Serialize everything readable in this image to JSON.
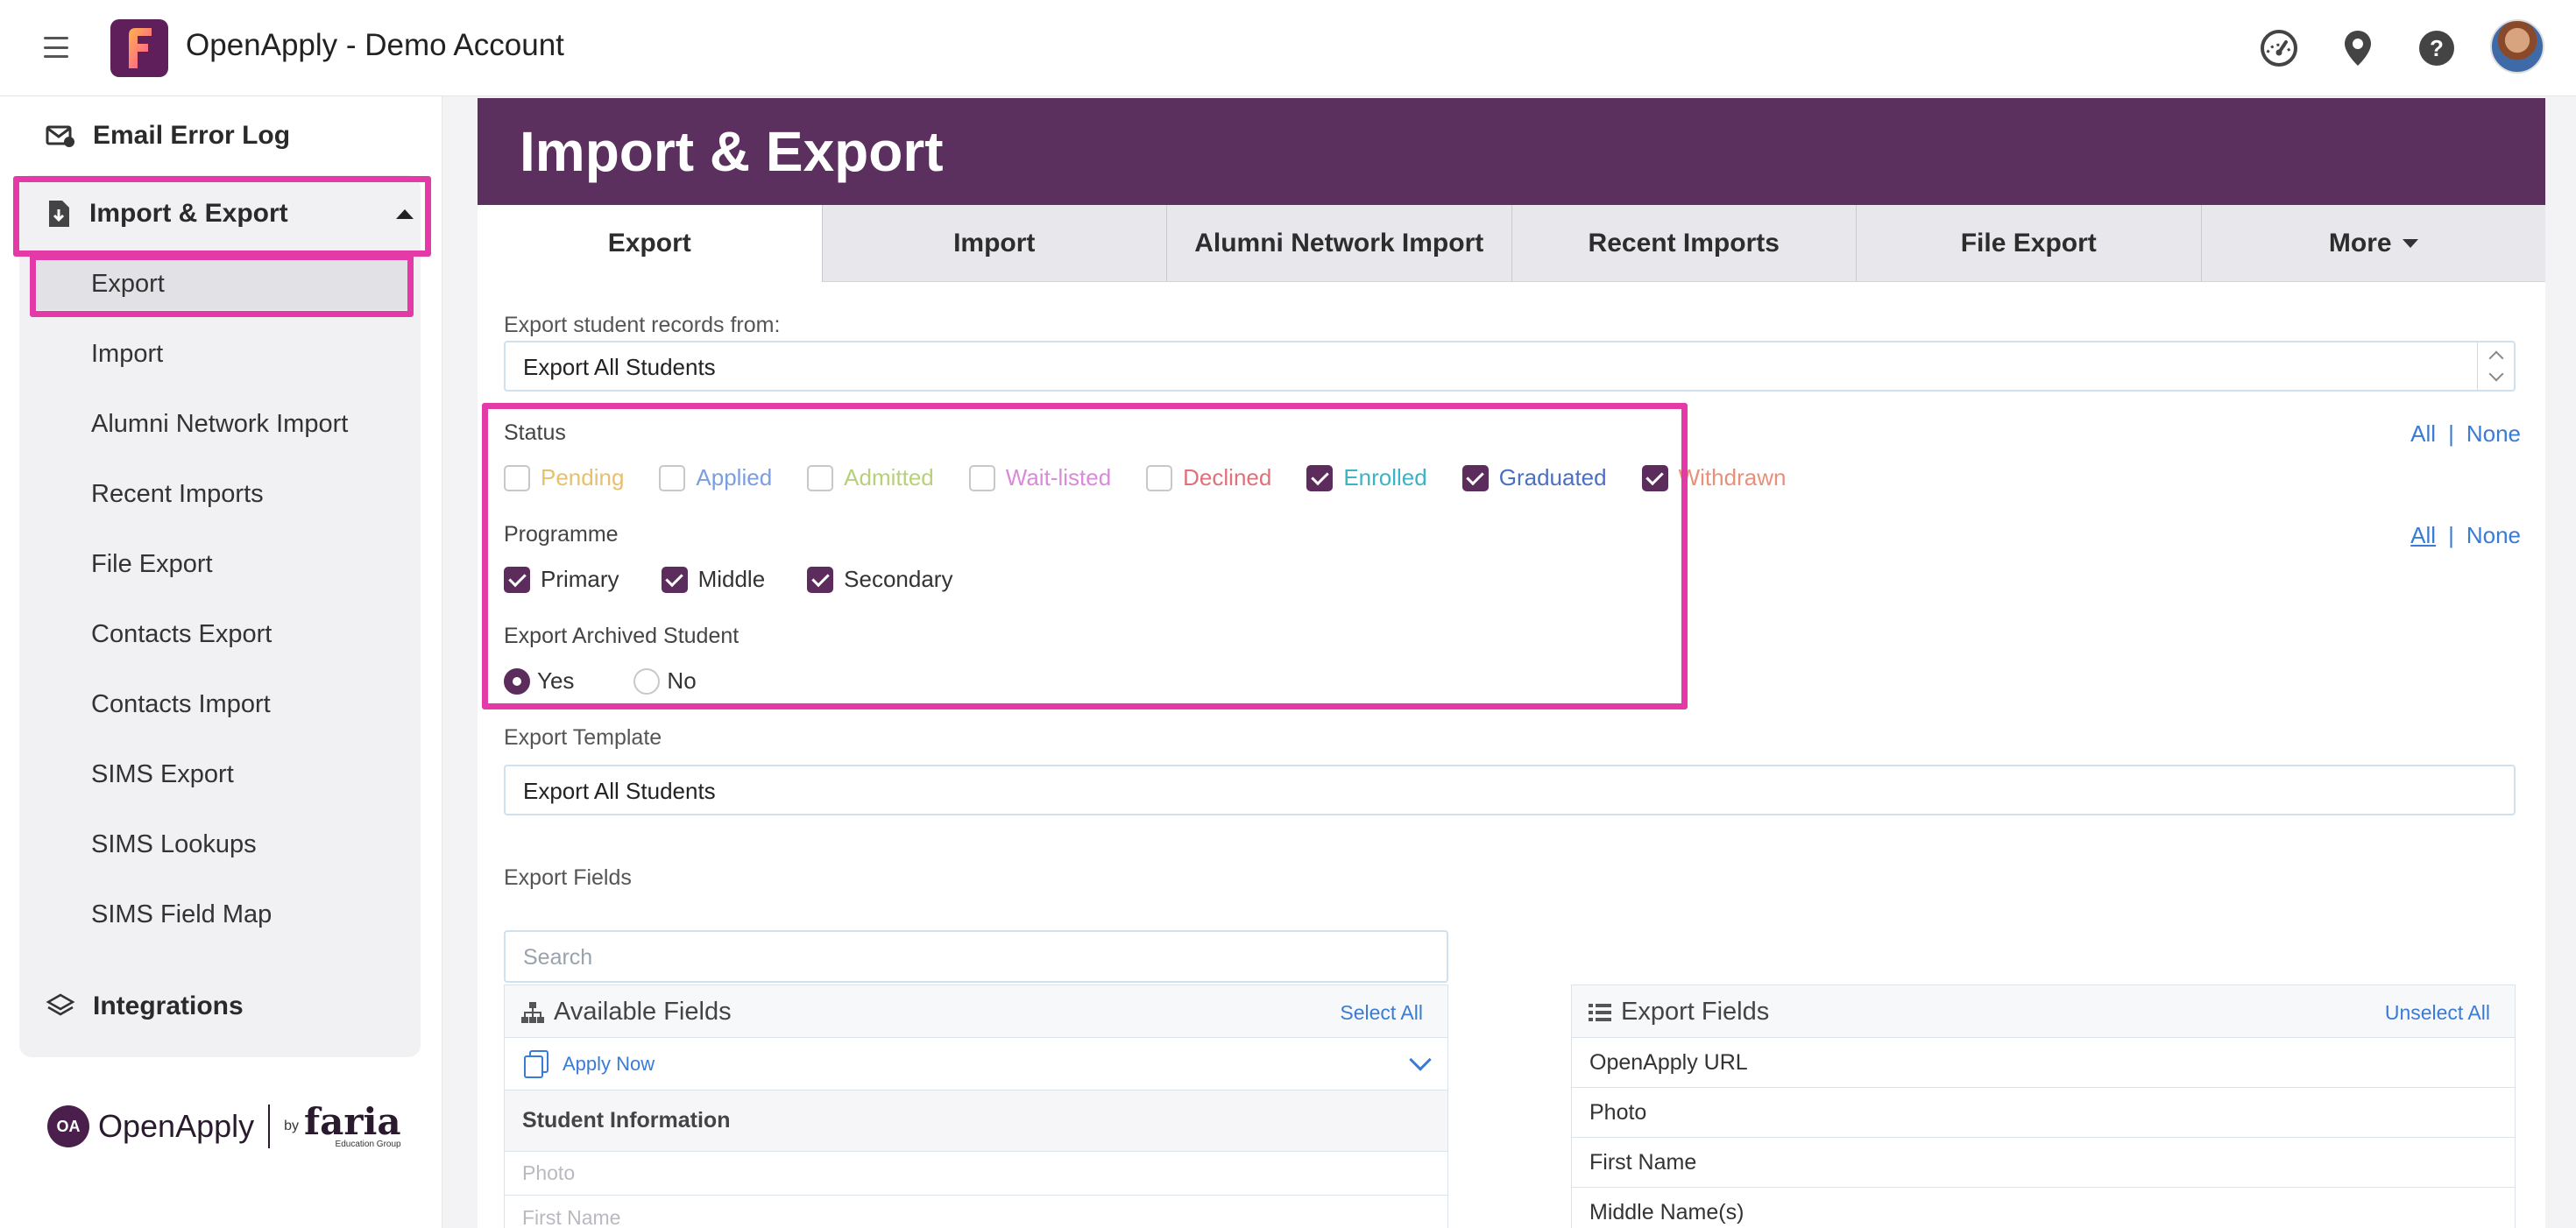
{
  "app": {
    "title": "OpenApply - Demo Account",
    "logo_letter": "F"
  },
  "sidebar": {
    "email_error_log": "Email Error Log",
    "import_export": "Import & Export",
    "sub_items": [
      "Export",
      "Import",
      "Alumni Network Import",
      "Recent Imports",
      "File Export",
      "Contacts Export",
      "Contacts Import",
      "SIMS Export",
      "SIMS Lookups",
      "SIMS Field Map"
    ],
    "integrations": "Integrations",
    "footer": {
      "brand": "OpenApply",
      "by": "by",
      "company": "faria",
      "company_sub": "Education Group",
      "badge": "OA"
    }
  },
  "page": {
    "title": "Import & Export",
    "tabs": [
      "Export",
      "Import",
      "Alumni Network Import",
      "Recent Imports",
      "File Export",
      "More"
    ],
    "export_from_label": "Export student records from:",
    "export_from_value": "Export All Students",
    "status_label": "Status",
    "statuses": [
      {
        "label": "Pending",
        "checked": false,
        "color": "#e8c06b"
      },
      {
        "label": "Applied",
        "checked": false,
        "color": "#7a9ee0"
      },
      {
        "label": "Admitted",
        "checked": false,
        "color": "#b8d07a"
      },
      {
        "label": "Wait-listed",
        "checked": false,
        "color": "#d98ad9"
      },
      {
        "label": "Declined",
        "checked": false,
        "color": "#e0707a"
      },
      {
        "label": "Enrolled",
        "checked": true,
        "color": "#3ab5c4"
      },
      {
        "label": "Graduated",
        "checked": true,
        "color": "#4a6fc4"
      },
      {
        "label": "Withdrawn",
        "checked": true,
        "color": "#e8907a"
      }
    ],
    "programme_label": "Programme",
    "programmes": [
      {
        "label": "Primary",
        "checked": true
      },
      {
        "label": "Middle",
        "checked": true
      },
      {
        "label": "Secondary",
        "checked": true
      }
    ],
    "archived_label": "Export Archived Student",
    "archived_options": [
      {
        "label": "Yes",
        "selected": true
      },
      {
        "label": "No",
        "selected": false
      }
    ],
    "all": "All",
    "separator": "|",
    "none": "None",
    "template_label": "Export Template",
    "template_value": "Export All Students",
    "export_fields_label": "Export Fields",
    "search_placeholder": "Search",
    "available": {
      "title": "Available Fields",
      "select_all": "Select All",
      "source": "Apply Now",
      "section": "Student Information",
      "fields": [
        "Photo",
        "First Name"
      ]
    },
    "export": {
      "title": "Export Fields",
      "unselect_all": "Unselect All",
      "fields": [
        "OpenApply URL",
        "Photo",
        "First Name",
        "Middle Name(s)"
      ]
    }
  },
  "colors": {
    "header_purple": "#5c305e",
    "highlight_pink": "#e33aa8",
    "link_blue": "#3a7bd5"
  }
}
